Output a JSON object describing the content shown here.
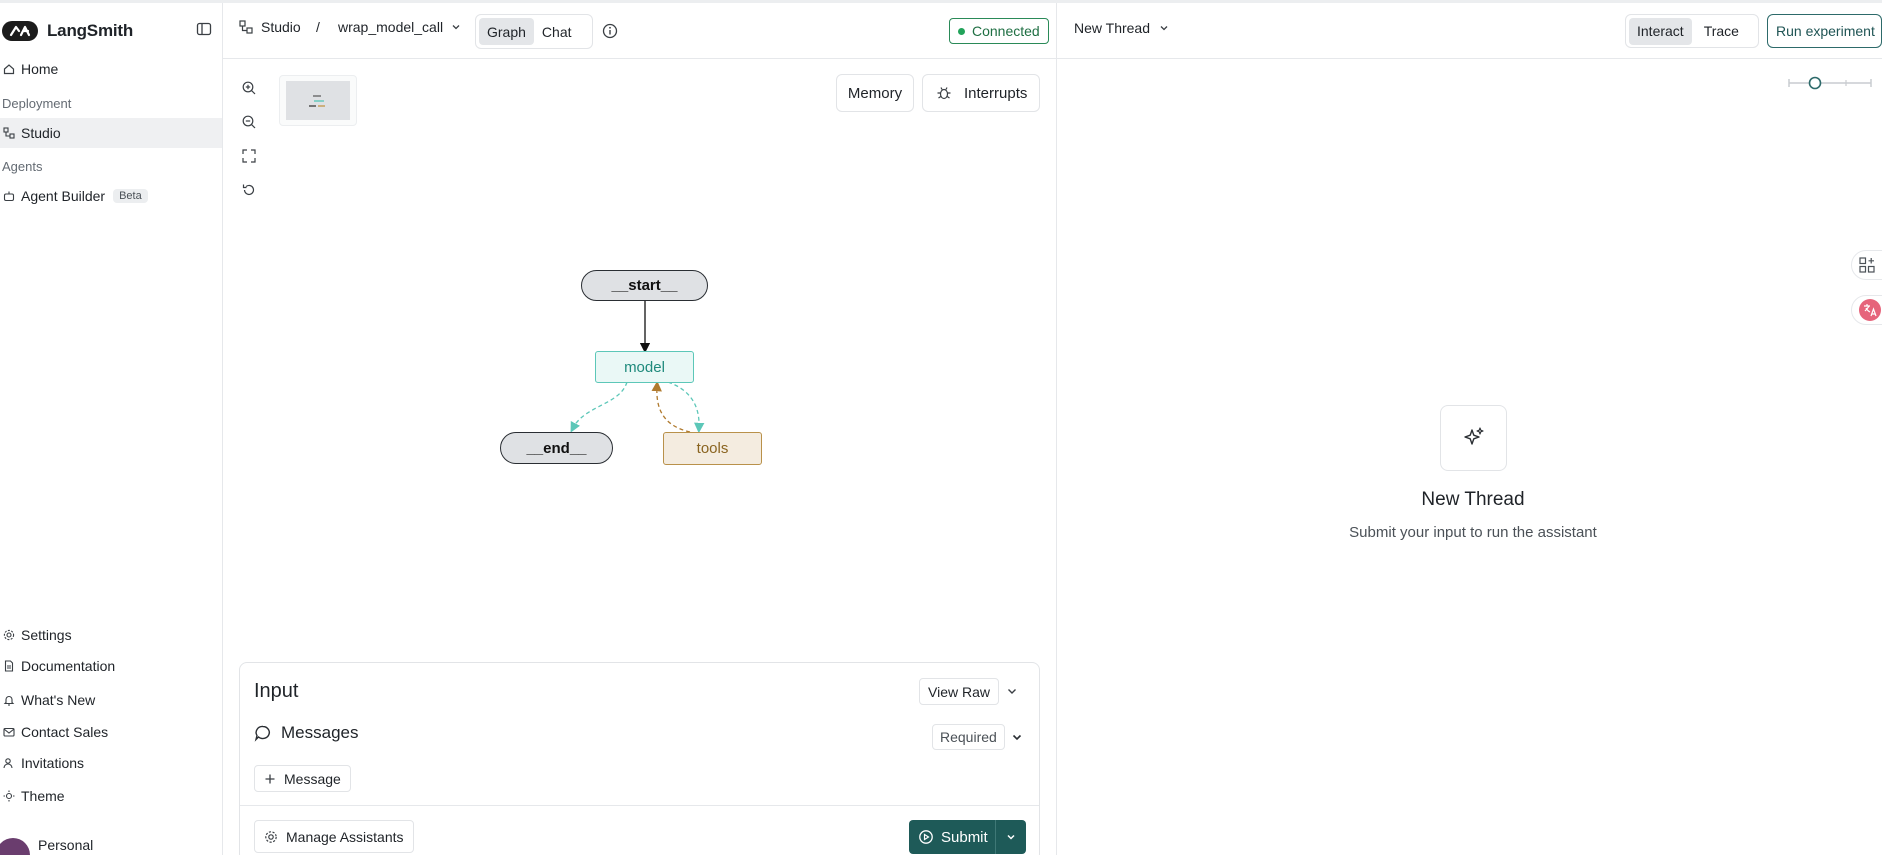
{
  "sidebar": {
    "brand": "LangSmith",
    "items": [
      {
        "label": "Home"
      },
      {
        "section": "Deployment"
      },
      {
        "label": "Studio",
        "active": true
      },
      {
        "section": "Agents"
      },
      {
        "label": "Agent Builder",
        "badge": "Beta"
      }
    ],
    "bottom_items": [
      {
        "label": "Settings"
      },
      {
        "label": "Documentation"
      },
      {
        "label": "What's New"
      },
      {
        "label": "Contact Sales"
      },
      {
        "label": "Invitations"
      },
      {
        "label": "Theme"
      }
    ],
    "workspace": "Personal"
  },
  "header": {
    "studio": "Studio",
    "separator": "/",
    "graph_name": "wrap_model_call",
    "view_tabs": [
      {
        "label": "Graph",
        "active": true
      },
      {
        "label": "Chat",
        "active": false
      }
    ],
    "connection_status": "Connected",
    "thread": "New Thread",
    "mode_tabs": [
      {
        "label": "Interact",
        "active": true
      },
      {
        "label": "Trace",
        "active": false
      }
    ],
    "run_experiment": "Run experiment"
  },
  "graph": {
    "memory_button": "Memory",
    "interrupts_button": "Interrupts",
    "nodes": {
      "start": "__start__",
      "model": "model",
      "end": "__end__",
      "tools": "tools"
    },
    "colors": {
      "model_border": "#5cc7b8",
      "model_text": "#1f8a7c",
      "tools_border": "#b9914a",
      "tools_text": "#8a6420",
      "tools_fill": "#f4ece0",
      "terminal_fill": "#dfe1e4"
    }
  },
  "input": {
    "title": "Input",
    "view_raw": "View Raw",
    "messages_label": "Messages",
    "required": "Required",
    "add_message": "Message",
    "manage_assistants": "Manage Assistants",
    "submit": "Submit"
  },
  "thread_panel": {
    "empty_title": "New Thread",
    "empty_subtitle": "Submit your input to run the assistant"
  },
  "colors": {
    "accent": "#1e5a58",
    "connected": "#22a35a"
  }
}
